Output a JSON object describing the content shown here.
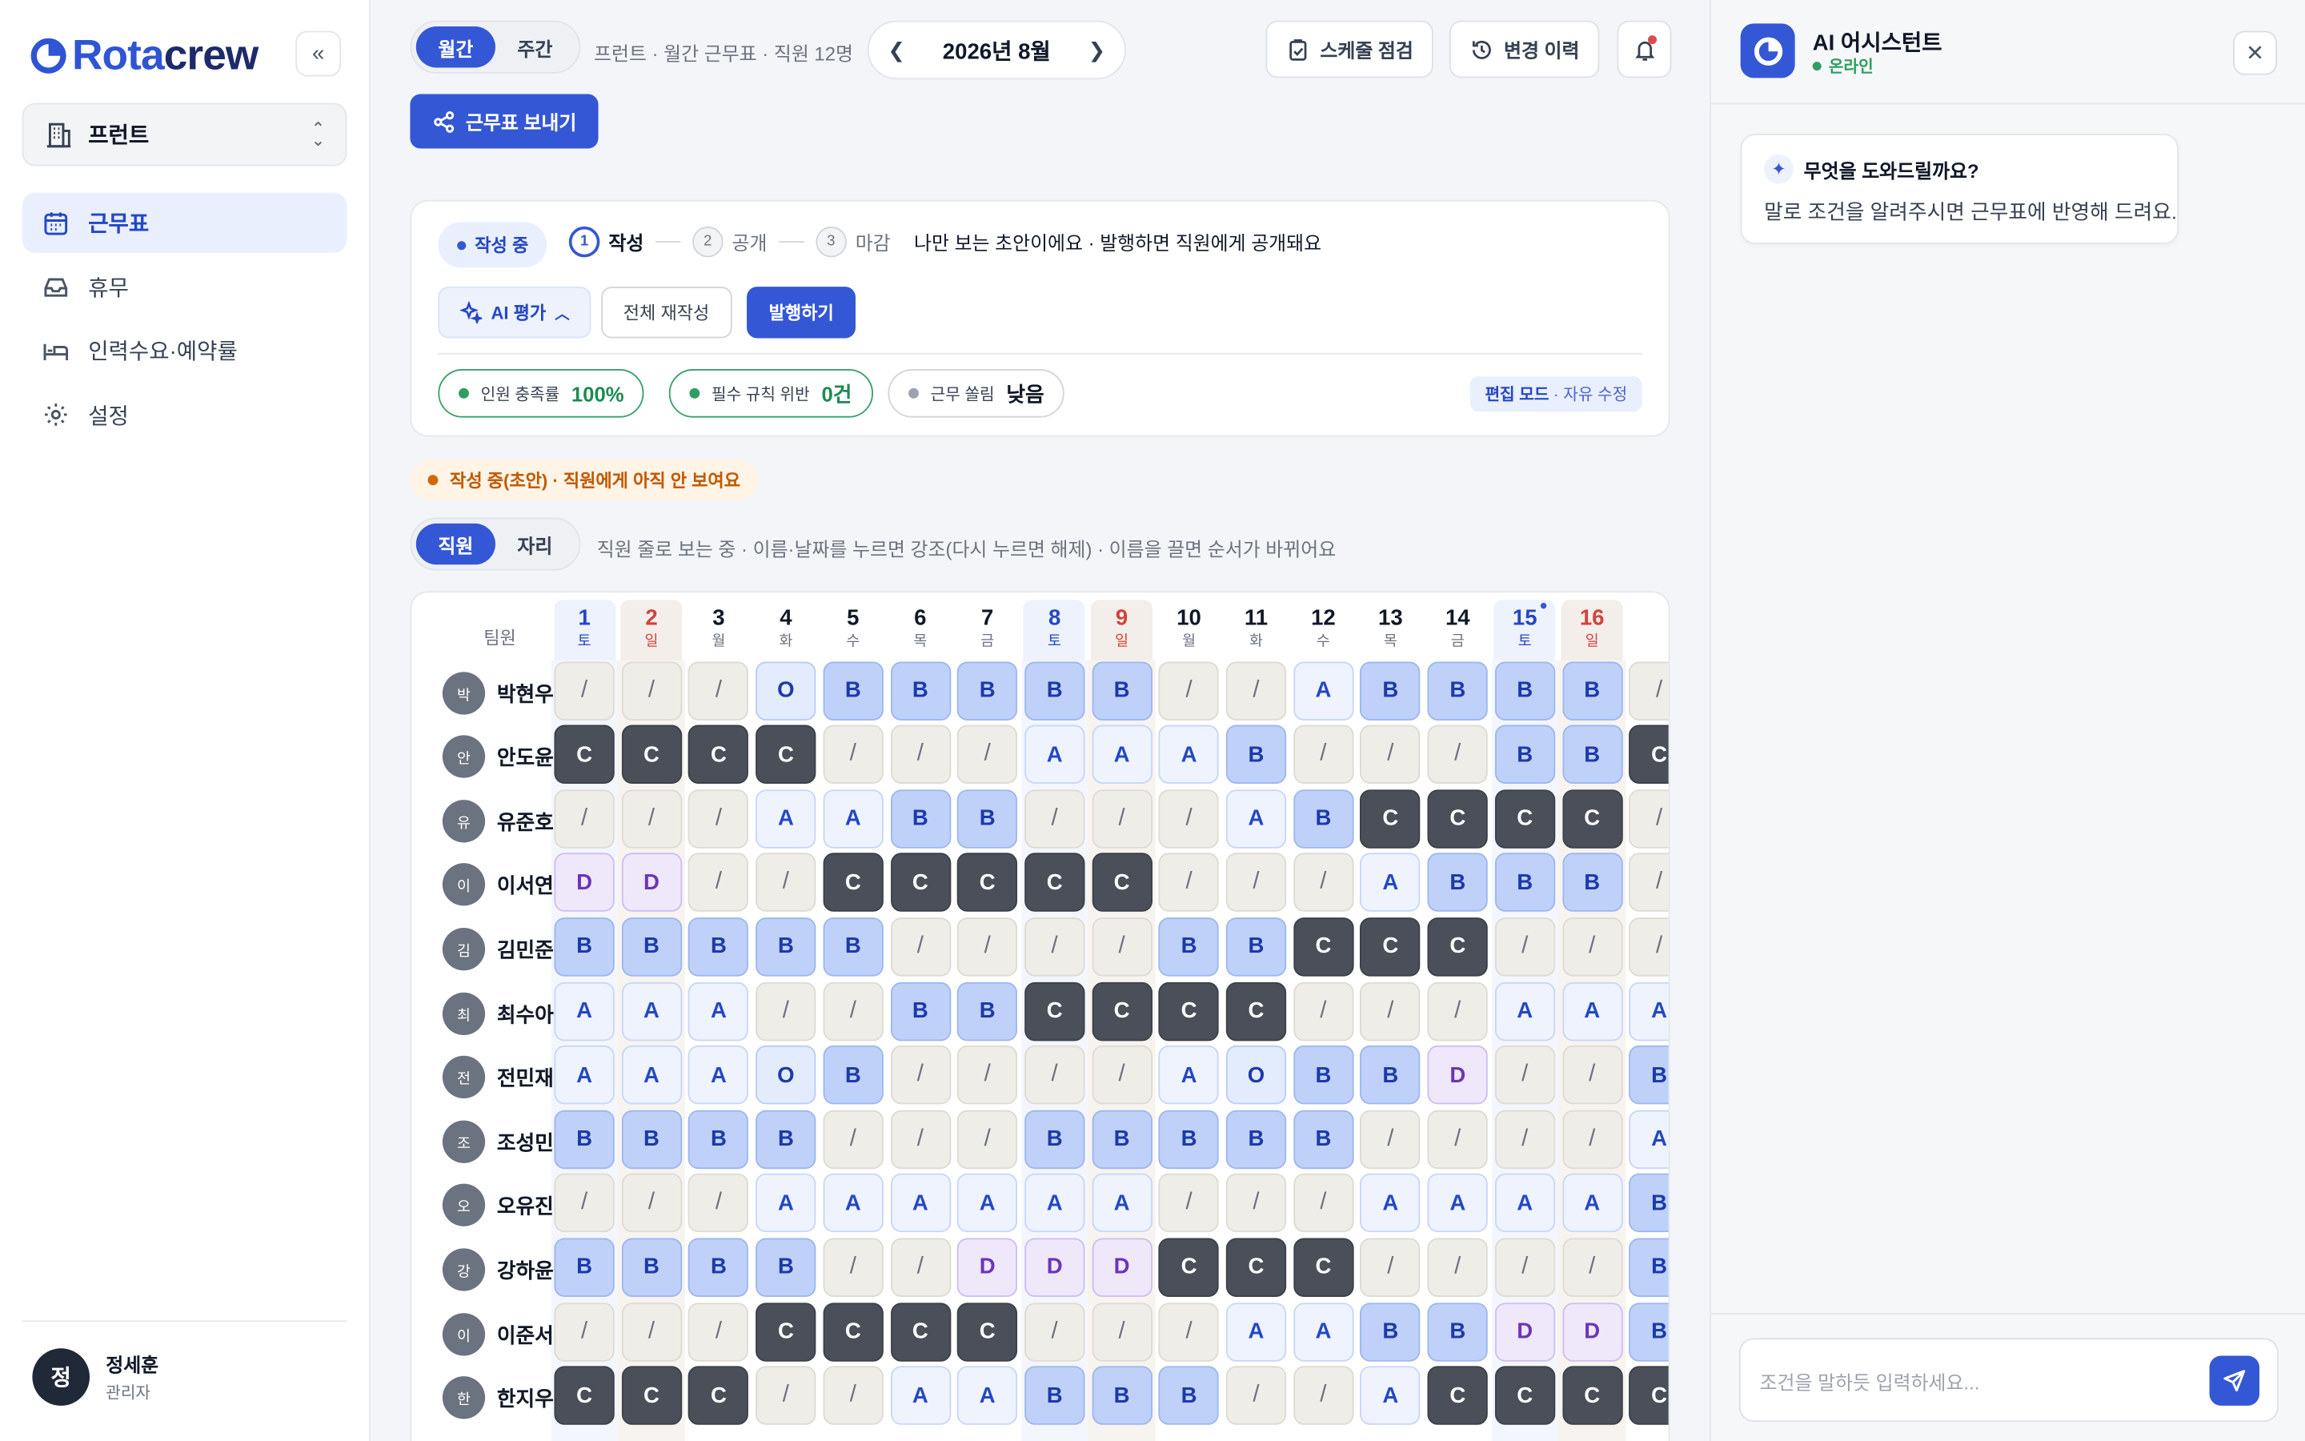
{
  "brand": {
    "name_part1": "Rota",
    "name_part2": "crew",
    "accent": "#3457d5"
  },
  "sidebar": {
    "collapse_icon": "double-chevron-left-icon",
    "store": {
      "name": "프런트",
      "icon": "building-icon"
    },
    "nav": [
      {
        "label": "근무표",
        "icon": "calendar-icon",
        "active": true
      },
      {
        "label": "휴무",
        "icon": "inbox-icon",
        "active": false
      },
      {
        "label": "인력수요·예약률",
        "icon": "bed-icon",
        "active": false
      },
      {
        "label": "설정",
        "icon": "gear-icon",
        "active": false
      }
    ],
    "user": {
      "initial": "정",
      "name": "정세훈",
      "role": "관리자"
    }
  },
  "topbar": {
    "view_tabs": [
      "월간",
      "주간"
    ],
    "active_view": "월간",
    "info": "프런트 · 월간 근무표 · 직원 12명",
    "month": "2026년 8월",
    "check_btn": "스케줄 점검",
    "history_btn": "변경 이력",
    "send_btn": "근무표 보내기"
  },
  "status_card": {
    "draft_pill": "작성 중",
    "steps": [
      {
        "num": "1",
        "label": "작성",
        "active": true
      },
      {
        "num": "2",
        "label": "공개",
        "active": false
      },
      {
        "num": "3",
        "label": "마감",
        "active": false
      }
    ],
    "note": "나만 보는 초안이에요 · 발행하면 직원에게 공개돼요",
    "ai_eval": "AI 평가",
    "redo": "전체 재작성",
    "publish": "발행하기",
    "metrics": [
      {
        "label": "인원 충족률",
        "value": "100%",
        "tone": "good"
      },
      {
        "label": "필수 규칙 위반",
        "value": "0건",
        "tone": "good"
      },
      {
        "label": "근무 쏠림",
        "value": "낮음",
        "tone": "neutral"
      }
    ],
    "edit_mode": {
      "label": "편집 모드",
      "desc": "· 자유 수정"
    }
  },
  "draft_banner": "작성 중(초안) · 직원에게 아직 안 보여요",
  "view_toggle": {
    "tabs": [
      "직원",
      "자리"
    ],
    "active": "직원",
    "hint": "직원 줄로 보는 중 · 이름·날짜를 누르면 강조(다시 누르면 해제) · 이름을 끌면 순서가 바뀌어요"
  },
  "schedule": {
    "team_header": "팀원",
    "days": [
      {
        "d": "1",
        "w": "토",
        "type": "sat"
      },
      {
        "d": "2",
        "w": "일",
        "type": "sun"
      },
      {
        "d": "3",
        "w": "월",
        "type": "wd"
      },
      {
        "d": "4",
        "w": "화",
        "type": "wd"
      },
      {
        "d": "5",
        "w": "수",
        "type": "wd"
      },
      {
        "d": "6",
        "w": "목",
        "type": "wd"
      },
      {
        "d": "7",
        "w": "금",
        "type": "wd"
      },
      {
        "d": "8",
        "w": "토",
        "type": "sat"
      },
      {
        "d": "9",
        "w": "일",
        "type": "sun"
      },
      {
        "d": "10",
        "w": "월",
        "type": "wd"
      },
      {
        "d": "11",
        "w": "화",
        "type": "wd"
      },
      {
        "d": "12",
        "w": "수",
        "type": "wd"
      },
      {
        "d": "13",
        "w": "목",
        "type": "wd"
      },
      {
        "d": "14",
        "w": "금",
        "type": "wd"
      },
      {
        "d": "15",
        "w": "토",
        "type": "sat",
        "mark": true
      },
      {
        "d": "16",
        "w": "일",
        "type": "sun"
      }
    ],
    "staff": [
      {
        "initial": "박",
        "name": "박현우",
        "shifts": [
          "/",
          "/",
          "/",
          "O",
          "B",
          "B",
          "B",
          "B",
          "B",
          "/",
          "/",
          "A",
          "B",
          "B",
          "B",
          "B"
        ],
        "next": "/"
      },
      {
        "initial": "안",
        "name": "안도윤",
        "shifts": [
          "C",
          "C",
          "C",
          "C",
          "/",
          "/",
          "/",
          "A",
          "A",
          "A",
          "B",
          "/",
          "/",
          "/",
          "B",
          "B"
        ],
        "next": "C"
      },
      {
        "initial": "유",
        "name": "유준호",
        "shifts": [
          "/",
          "/",
          "/",
          "A",
          "A",
          "B",
          "B",
          "/",
          "/",
          "/",
          "A",
          "B",
          "C",
          "C",
          "C",
          "C"
        ],
        "next": "/"
      },
      {
        "initial": "이",
        "name": "이서연",
        "shifts": [
          "D",
          "D",
          "/",
          "/",
          "C",
          "C",
          "C",
          "C",
          "C",
          "/",
          "/",
          "/",
          "A",
          "B",
          "B",
          "B"
        ],
        "next": "/"
      },
      {
        "initial": "김",
        "name": "김민준",
        "shifts": [
          "B",
          "B",
          "B",
          "B",
          "B",
          "/",
          "/",
          "/",
          "/",
          "B",
          "B",
          "C",
          "C",
          "C",
          "/",
          "/"
        ],
        "next": "/"
      },
      {
        "initial": "최",
        "name": "최수아",
        "shifts": [
          "A",
          "A",
          "A",
          "/",
          "/",
          "B",
          "B",
          "C",
          "C",
          "C",
          "C",
          "/",
          "/",
          "/",
          "A",
          "A"
        ],
        "next": "A"
      },
      {
        "initial": "전",
        "name": "전민재",
        "shifts": [
          "A",
          "A",
          "A",
          "O",
          "B",
          "/",
          "/",
          "/",
          "/",
          "A",
          "O",
          "B",
          "B",
          "D",
          "/",
          "/"
        ],
        "next": "B"
      },
      {
        "initial": "조",
        "name": "조성민",
        "shifts": [
          "B",
          "B",
          "B",
          "B",
          "/",
          "/",
          "/",
          "B",
          "B",
          "B",
          "B",
          "B",
          "/",
          "/",
          "/",
          "/"
        ],
        "next": "A"
      },
      {
        "initial": "오",
        "name": "오유진",
        "shifts": [
          "/",
          "/",
          "/",
          "A",
          "A",
          "A",
          "A",
          "A",
          "A",
          "/",
          "/",
          "/",
          "A",
          "A",
          "A",
          "A"
        ],
        "next": "B"
      },
      {
        "initial": "강",
        "name": "강하윤",
        "shifts": [
          "B",
          "B",
          "B",
          "B",
          "/",
          "/",
          "D",
          "D",
          "D",
          "C",
          "C",
          "C",
          "/",
          "/",
          "/",
          "/"
        ],
        "next": "B"
      },
      {
        "initial": "이",
        "name": "이준서",
        "shifts": [
          "/",
          "/",
          "/",
          "C",
          "C",
          "C",
          "C",
          "/",
          "/",
          "/",
          "A",
          "A",
          "B",
          "B",
          "D",
          "D"
        ],
        "next": "B"
      },
      {
        "initial": "한",
        "name": "한지우",
        "shifts": [
          "C",
          "C",
          "C",
          "/",
          "/",
          "A",
          "A",
          "B",
          "B",
          "B",
          "/",
          "/",
          "A",
          "C",
          "C",
          "C"
        ],
        "next": "C"
      }
    ]
  },
  "assistant": {
    "title": "AI 어시스턴트",
    "status": "온라인",
    "greeting_title": "무엇을 도와드릴까요?",
    "greeting_body": "말로 조건을 알려주시면 근무표에 반영해 드려요.",
    "input_placeholder": "조건을 말하듯 입력하세요..."
  }
}
